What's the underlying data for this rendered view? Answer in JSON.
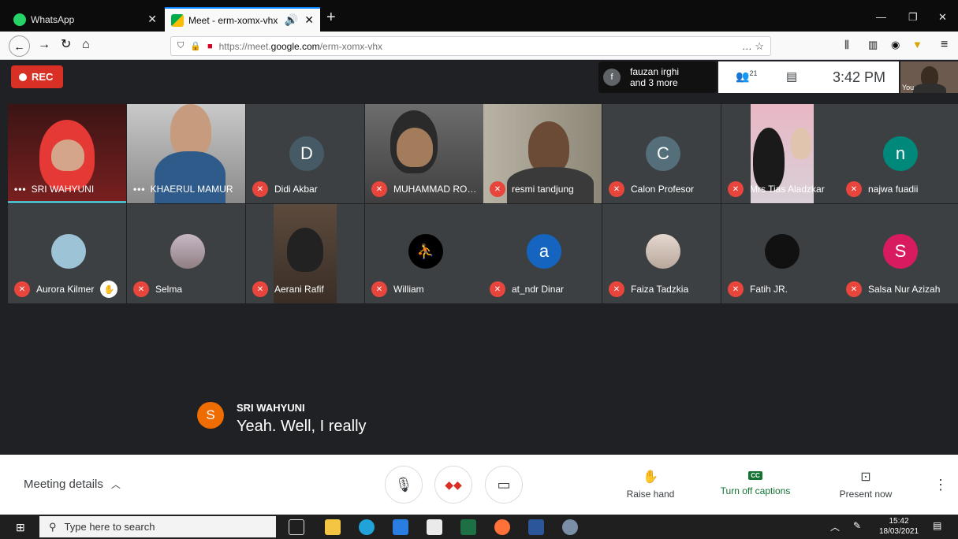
{
  "browser": {
    "tabs": [
      {
        "label": "WhatsApp",
        "active": false
      },
      {
        "label": "Meet - erm-xomx-vhx",
        "active": true
      }
    ],
    "url_prefix": "https://meet.",
    "url_domain": "google.com",
    "url_path": "/erm-xomx-vhx",
    "url_more": "…"
  },
  "meet": {
    "rec_label": "REC",
    "speaker_chip": {
      "initial": "f",
      "line1": "fauzan irghi",
      "line2": "and 3 more"
    },
    "people_count": "21",
    "clock": "3:42 PM",
    "self_label": "You",
    "row1": [
      {
        "name": "SRI WAHYUNI",
        "type": "video",
        "speaking": true,
        "muted": false
      },
      {
        "name": "KHAERUL MAMUR",
        "type": "video",
        "speaking": true,
        "muted": false
      },
      {
        "name": "Didi Akbar",
        "type": "avatar",
        "initial": "D",
        "color": "#455a64",
        "muted": true
      },
      {
        "name": "MUHAMMAD RO…",
        "type": "video",
        "muted": true
      },
      {
        "name": "resmi tandjung",
        "type": "video",
        "muted": true
      },
      {
        "name": "Calon Profesor",
        "type": "avatar",
        "initial": "C",
        "color": "#546e7a",
        "muted": true
      },
      {
        "name": "Mrs Tias Aladzkar",
        "type": "video",
        "muted": true
      },
      {
        "name": "najwa fuadii",
        "type": "avatar",
        "initial": "n",
        "color": "#00897b",
        "muted": true
      }
    ],
    "row2": [
      {
        "name": "Aurora Kilmer",
        "type": "photo",
        "color": "#9cc3d6",
        "muted": true,
        "hand": true
      },
      {
        "name": "Selma",
        "type": "photo",
        "color": "#b9a9b4",
        "muted": true
      },
      {
        "name": "Aerani Rafif",
        "type": "video",
        "muted": true
      },
      {
        "name": "William",
        "type": "photo",
        "color": "#000000",
        "muted": true
      },
      {
        "name": "at_ndr Dinar",
        "type": "avatar",
        "initial": "a",
        "color": "#1565c0",
        "muted": true
      },
      {
        "name": "Faiza Tadzkia",
        "type": "photo",
        "color": "#cdbcb0",
        "muted": true
      },
      {
        "name": "Fatih JR.",
        "type": "photo",
        "color": "#111111",
        "muted": true
      },
      {
        "name": "Salsa Nur Azizah",
        "type": "avatar",
        "initial": "S",
        "color": "#d81b60",
        "muted": true
      }
    ],
    "caption": {
      "initial": "S",
      "speaker": "SRI WAHYUNI",
      "text": "Yeah. Well, I really"
    }
  },
  "controls": {
    "meeting_details": "Meeting details",
    "raise_hand": "Raise hand",
    "captions": "Turn off captions",
    "cc_badge": "CC",
    "present": "Present now"
  },
  "taskbar": {
    "search_placeholder": "Type here to search",
    "time": "15:42",
    "date": "18/03/2021"
  },
  "colors": {
    "accent": "#0a84ff",
    "mute_red": "#e8453c",
    "rec_red": "#d93025",
    "captions_green": "#137333",
    "speaking_teal": "#4fb6c4"
  }
}
